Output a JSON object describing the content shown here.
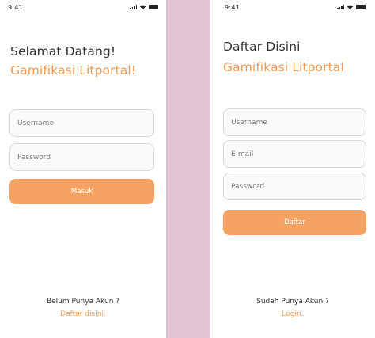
{
  "status_bar": {
    "time": "9:41",
    "icons": [
      "signal-icon",
      "wifi-icon",
      "battery-icon"
    ]
  },
  "colors": {
    "accent": "#f29a52",
    "button": "#f6a262",
    "divider": "#e0c4d3",
    "field_border": "#d9d9d9"
  },
  "login": {
    "title": "Selamat Datang!",
    "subtitle": "Gamifikasi Litportal!",
    "username_placeholder": "Username",
    "password_placeholder": "Password",
    "button_label": "Masuk",
    "prompt": "Belum Punya Akun ?",
    "link": "Daftar disini."
  },
  "register": {
    "title": "Daftar Disini",
    "subtitle": "Gamifikasi Litportal",
    "username_placeholder": "Username",
    "email_placeholder": "E-mail",
    "password_placeholder": "Password",
    "button_label": "Daftar",
    "prompt": "Sudah Punya Akun ?",
    "link": "Login."
  }
}
